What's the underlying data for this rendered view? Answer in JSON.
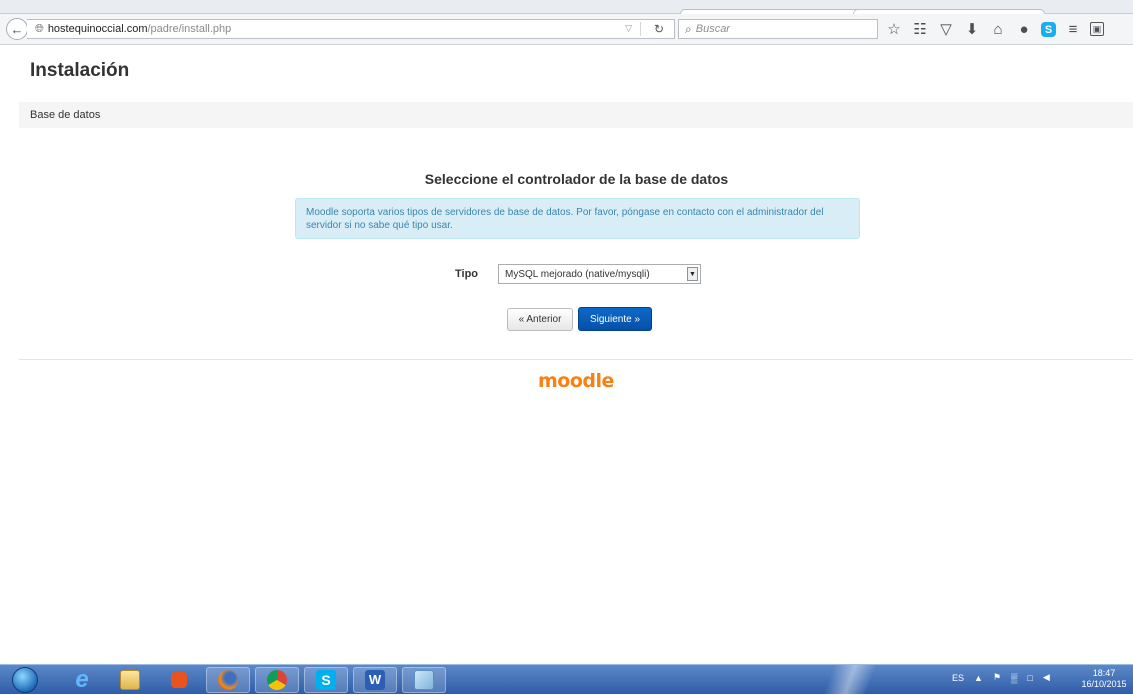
{
  "browser": {
    "url_host": "hostequinoccial.com",
    "url_path": "/padre/install.php",
    "search_placeholder": "Buscar",
    "toolbar_icons": [
      "star-icon",
      "reading-list-icon",
      "pocket-icon",
      "download-icon",
      "home-icon",
      "chat-icon",
      "skype-icon",
      "menu-icon",
      "window-icon"
    ]
  },
  "page": {
    "title": "Instalación",
    "breadcrumb": "Base de datos",
    "heading": "Seleccione el controlador de la base de datos",
    "info_line1": "Moodle soporta varios tipos de servidores de base de datos. Por favor, póngase en contacto con el administrador del",
    "info_line2": "servidor si no sabe qué tipo usar.",
    "tipo_label": "Tipo",
    "tipo_value": "MySQL mejorado (native/mysqli)",
    "prev_button": "« Anterior",
    "next_button": "Siguiente »",
    "logo_text": "moodle"
  },
  "taskbar": {
    "apps": [
      "internet-explorer-icon",
      "file-explorer-icon",
      "media-player-icon",
      "firefox-icon",
      "chrome-icon",
      "skype-icon",
      "word-icon",
      "paint-icon"
    ],
    "language": "ES",
    "time": "18:47",
    "date": "16/10/2015"
  },
  "colors": {
    "alert_bg": "#d9edf7",
    "alert_text": "#3a87ad",
    "primary_button": "#0e69c9",
    "moodle_orange": "#f98012"
  }
}
